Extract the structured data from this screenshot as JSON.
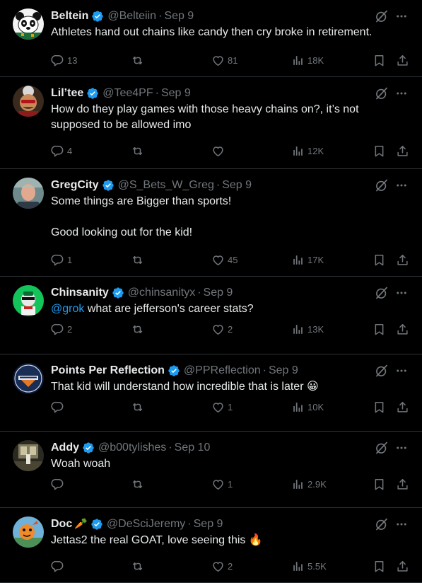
{
  "colors": {
    "background": "#000000",
    "text": "#e7e9ea",
    "secondary": "#71767b",
    "accent": "#1d9bf0",
    "divider": "#2f3336"
  },
  "tweets": [
    {
      "name": "Beltein",
      "verified": true,
      "handle": "@Belteiin",
      "date": "Sep 9",
      "text": "Athletes hand out chains like candy then cry broke in retirement.",
      "replies": "13",
      "retweets": "",
      "likes": "81",
      "views": "18K",
      "avatar_icon": "panda-avatar"
    },
    {
      "name": "Lil’tee",
      "verified": true,
      "handle": "@Tee4PF",
      "date": "Sep 9",
      "text": "How do they play games with those heavy chains on?, it’s not supposed to be allowed imo",
      "replies": "4",
      "retweets": "",
      "likes": "",
      "views": "12K",
      "avatar_icon": "cartoon-face-avatar"
    },
    {
      "name": "GregCity",
      "verified": true,
      "handle": "@S_Bets_W_Greg",
      "date": "Sep 9",
      "text": "Some things are Bigger than sports!\n\nGood looking out for the kid!",
      "replies": "1",
      "retweets": "",
      "likes": "45",
      "views": "17K",
      "avatar_icon": "man-photo-avatar"
    },
    {
      "name": "Chinsanity",
      "verified": true,
      "handle": "@chinsanityx",
      "date": "Sep 9",
      "mention": "@grok",
      "text": " what are jefferson's career stats?",
      "replies": "2",
      "retweets": "",
      "likes": "2",
      "views": "13K",
      "avatar_icon": "green-character-avatar"
    },
    {
      "name": "Points Per Reflection",
      "verified": true,
      "handle": "@PPReflection",
      "date": "Sep 9",
      "text": "That kid will understand how incredible that is later 😀",
      "replies": "",
      "retweets": "",
      "likes": "1",
      "views": "10K",
      "avatar_icon": "podcast-logo-avatar"
    },
    {
      "name": "Addy",
      "verified": true,
      "handle": "@b00tylishes",
      "date": "Sep 10",
      "text": "Woah woah",
      "replies": "",
      "retweets": "",
      "likes": "1",
      "views": "2.9K",
      "avatar_icon": "room-photo-avatar"
    },
    {
      "name": "Doc",
      "name_emoji": "🥕",
      "verified": true,
      "handle": "@DeSciJeremy",
      "date": "Sep 9",
      "text": "Jettas2 the real GOAT, love seeing this 🔥",
      "replies": "",
      "retweets": "",
      "likes": "2",
      "views": "5.5K",
      "avatar_icon": "orange-character-avatar"
    }
  ]
}
